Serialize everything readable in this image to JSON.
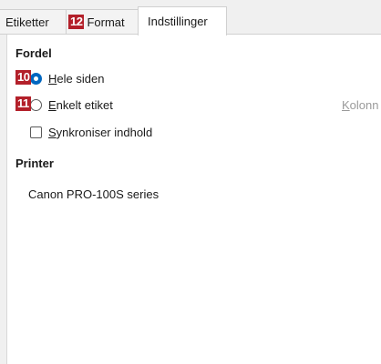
{
  "tabs": {
    "labels": "Etiketter",
    "badge12": "12",
    "format": "Format",
    "settings": "Indstillinger"
  },
  "distribution": {
    "heading": "Fordel",
    "badge10": "10",
    "badge11": "11",
    "whole_page_first": "H",
    "whole_page_rest": "ele siden",
    "single_label_first": "E",
    "single_label_rest": "nkelt etiket",
    "synchronize_first": "S",
    "synchronize_rest": "ynkroniser indhold",
    "column_label_first": "K",
    "column_label_rest": "olonn",
    "selected": "Hele siden"
  },
  "printer": {
    "heading": "Printer",
    "name": "Canon PRO-100S series"
  }
}
